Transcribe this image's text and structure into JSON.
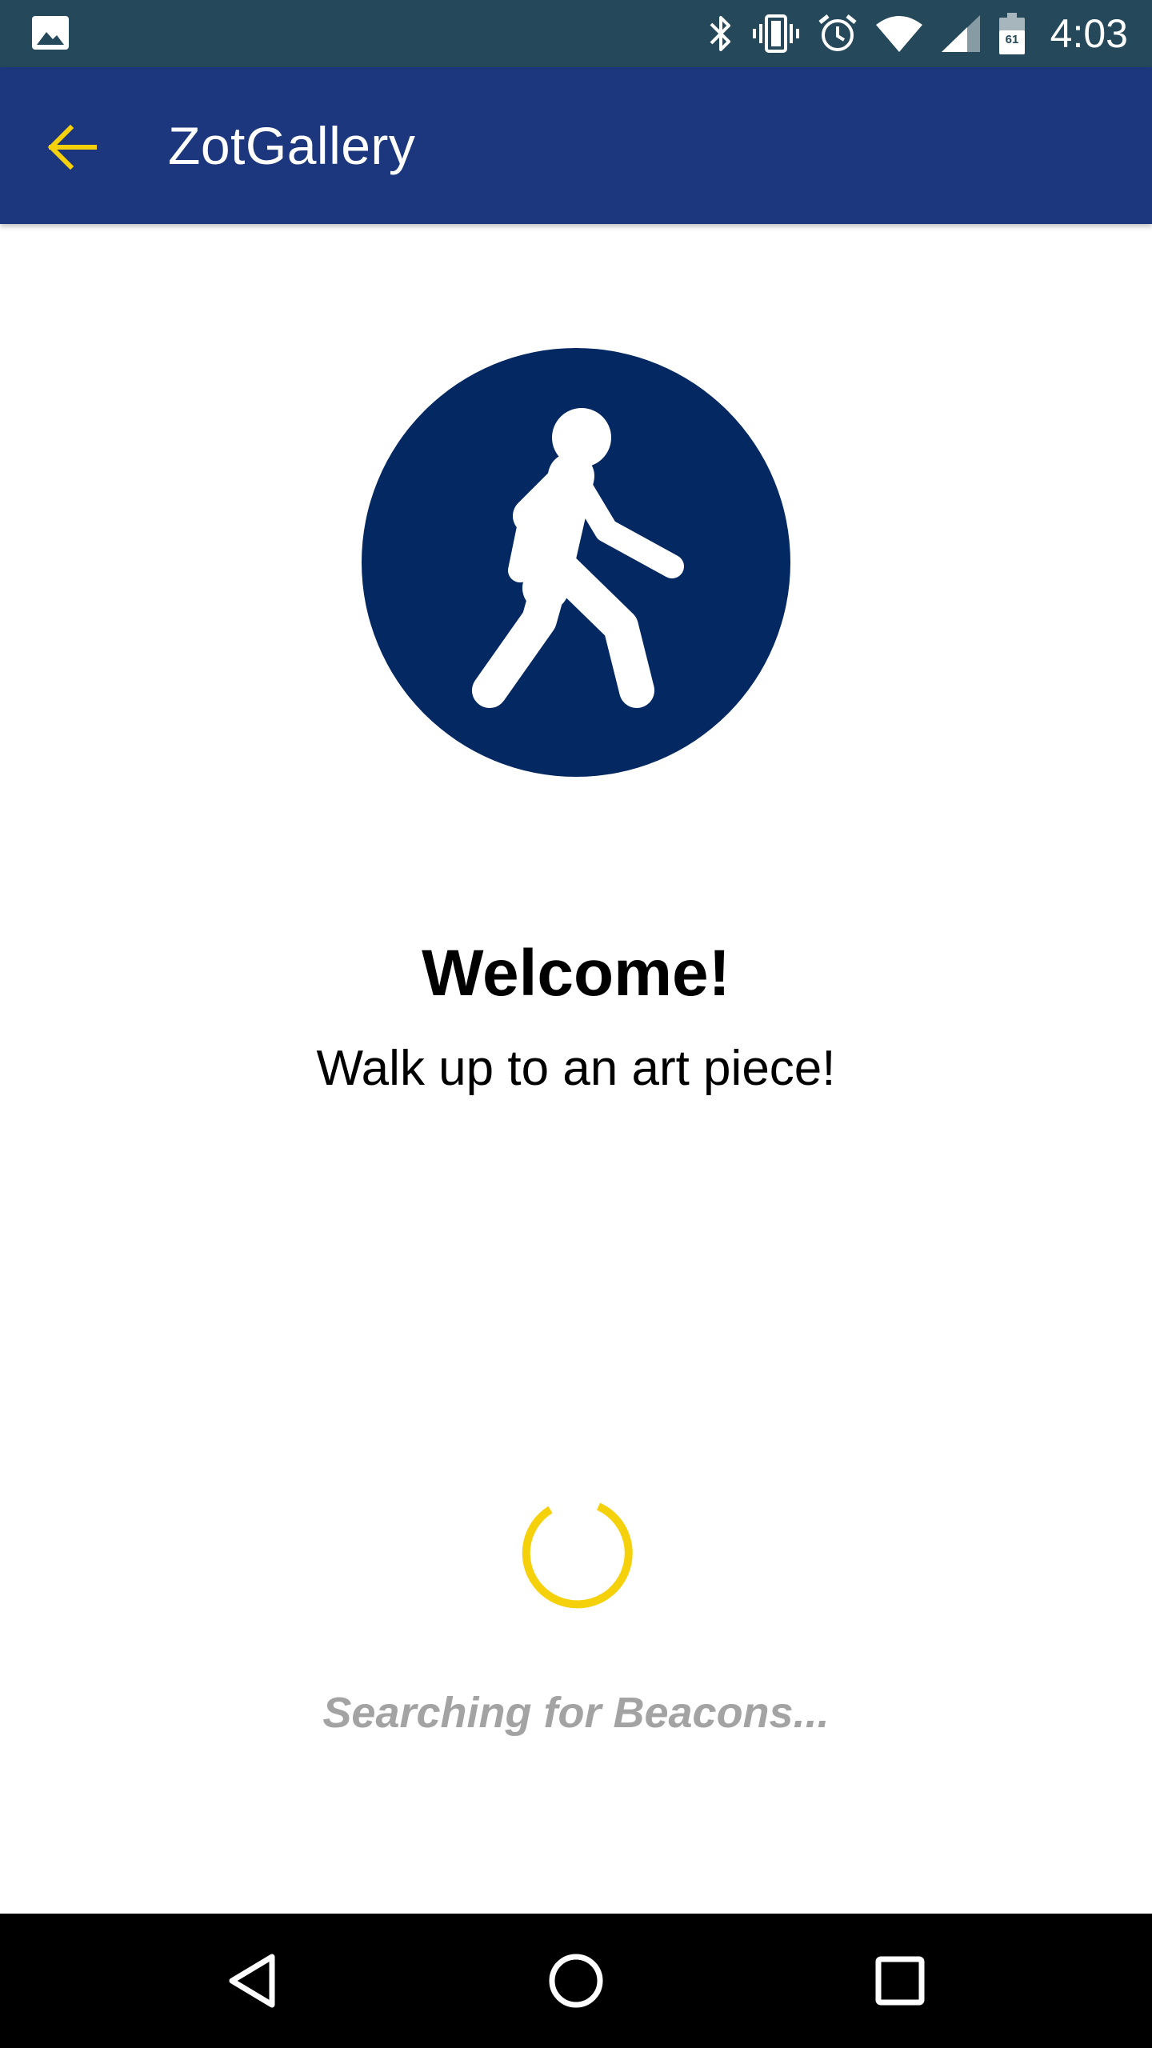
{
  "status_bar": {
    "time": "4:03",
    "battery_level": "61",
    "icons": [
      "image-icon",
      "bluetooth-icon",
      "vibrate-icon",
      "alarm-icon",
      "wifi-icon",
      "cell-signal-icon",
      "battery-icon"
    ]
  },
  "app_bar": {
    "title": "ZotGallery",
    "back_icon": "arrow-left-icon",
    "accent_color": "#f5d10b",
    "background_color": "#1d377e"
  },
  "main": {
    "illustration": "pedestrian-walking-icon",
    "illustration_color": "#042862",
    "welcome_title": "Welcome!",
    "welcome_subtitle": "Walk up to an art piece!",
    "spinner_color": "#f5d10b",
    "status_text": "Searching for Beacons..."
  },
  "nav_bar": {
    "buttons": [
      "back-triangle-icon",
      "home-circle-icon",
      "recents-square-icon"
    ]
  }
}
